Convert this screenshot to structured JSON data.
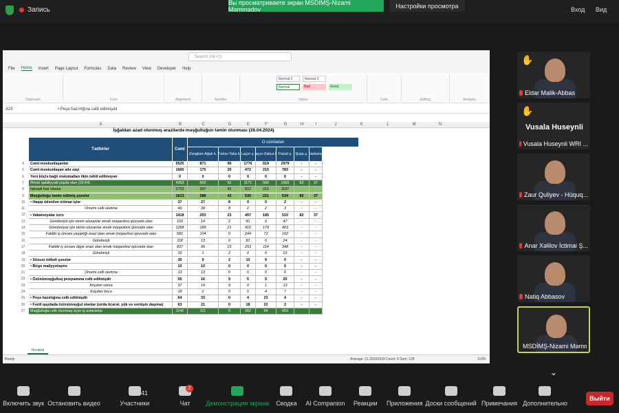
{
  "topbar": {
    "record_label": "Запись",
    "share_banner": "Вы просматриваете экран MSDİMŞ-Nizami Məmmədov",
    "view_settings": "Настройки просмотра",
    "enter_label": "Вход",
    "view_label": "Вид"
  },
  "excel": {
    "doc_title": "İşğaldan azad olunmuş ərazilərdə məşğulluğun təmin olunması (26.04.2024)",
    "search_placeholder": "Search (Alt+Q)",
    "menus": [
      "File",
      "Home",
      "Insert",
      "Page Layout",
      "Formulas",
      "Data",
      "Review",
      "View",
      "Developer",
      "Help"
    ],
    "cell_ref": "A25",
    "formula": "• Peşə hazırlığına cəlb edilmişdir",
    "styles": {
      "normal2": "Normal 2",
      "normal3": "Normal 3",
      "normal": "Normal",
      "bad": "Bad",
      "good": "Good"
    },
    "ribbon_groups": [
      "Clipboard",
      "Font",
      "Alignment",
      "Number",
      "Styles",
      "Cells",
      "Editing",
      "Analysis"
    ],
    "columns": [
      "A",
      "B",
      "C",
      "D",
      "E",
      "F",
      "G",
      "H",
      "I",
      "J",
      "K",
      "L",
      "M",
      "N"
    ],
    "headers": {
      "tadbirlar": "Tədbirlər",
      "cami": "Cəmi",
      "o_cumleden": "O cümlədən",
      "c1": "Zəngilan-Ağalı k.",
      "c2": "Tərtər-Talış k.",
      "c3": "Laçın ş.",
      "c4": "Laçın-Zabux k.",
      "c5": "Füzuli ş.",
      "c6": "Şuşa ş.",
      "c7": "Xankəndi"
    },
    "rows": [
      {
        "n": "4",
        "cls": "bold",
        "c": [
          "Cəmi məskunlaşanlar",
          "6525",
          "871",
          "90",
          "1776",
          "819",
          "2979",
          "-",
          "-"
        ]
      },
      {
        "n": "5",
        "cls": "bold",
        "c": [
          "Cəmi məskunlaşan ailə sayı",
          "1665",
          "175",
          "20",
          "472",
          "215",
          "783",
          "-",
          "-"
        ]
      },
      {
        "n": "6",
        "cls": "bold",
        "c": [
          "Yeni köçlə bağlı məlumatları ilkin təhlil edilməyən",
          "0",
          "0",
          "0",
          "0",
          "0",
          "0",
          "-",
          "-"
        ]
      },
      {
        "n": "7",
        "cls": "green",
        "c": [
          "Əmək qabiliyyətli yaşda olan (15-64)",
          "4353",
          "602",
          "52",
          "1171",
          "566",
          "1962",
          "82",
          "37"
        ]
      },
      {
        "n": "8",
        "cls": "lg",
        "c": [
          "İqtisadi fəal olanlar",
          "2753",
          "397",
          "42",
          "812",
          "315",
          "1187",
          "",
          ""
        ]
      },
      {
        "n": "9",
        "cls": "lg bold",
        "c": [
          "Məşğulluğu təmin edilmiş şəxslər",
          "1613",
          "286",
          "42",
          "530",
          "221",
          "534",
          "82",
          "37"
        ]
      },
      {
        "n": "10",
        "cls": "bold",
        "c": [
          "• Haqqı ödənilən ictimai işlər",
          "37",
          "27",
          "8",
          "0",
          "0",
          "2",
          "-",
          "-"
        ]
      },
      {
        "n": "11",
        "cls": "it",
        "c": [
          "Ümumi cəlb olunma",
          "49",
          "34",
          "8",
          "2",
          "2",
          "3",
          "-",
          "-"
        ]
      },
      {
        "n": "12",
        "cls": "bold",
        "c": [
          "• Vakansiyalar üzrə",
          "1418",
          "203",
          "23",
          "497",
          "185",
          "510",
          "82",
          "37"
        ]
      },
      {
        "n": "13",
        "cls": "it",
        "c": [
          "Gəndərişlə işlə təmin olunanlar əmək müqaviləsi qüvvədə olan",
          "150",
          "14",
          "2",
          "81",
          "6",
          "47",
          "-",
          "-"
        ]
      },
      {
        "n": "14",
        "cls": "it",
        "c": [
          "Göndərişsiz işlə təmin olunanlar əmək müqaviləsi qüvvədə olan",
          "1268",
          "189",
          "21",
          "416",
          "179",
          "463",
          "-",
          "-"
        ]
      },
      {
        "n": "15",
        "cls": "it",
        "c": [
          "Faktiki iş ünvanı yaşadığı ərazi olan əmək müqaviləsi qüvvədə olan",
          "581",
          "104",
          "0",
          "244",
          "71",
          "162",
          "-",
          "-"
        ]
      },
      {
        "n": "16",
        "cls": "it",
        "c": [
          "Göndərişli",
          "118",
          "13",
          "0",
          "81",
          "0",
          "24",
          "-",
          "-"
        ]
      },
      {
        "n": "17",
        "cls": "it",
        "c": [
          "Faktiki iş ünvanı digər ərazi olan əmək müqaviləsi qüvvədə olan",
          "837",
          "99",
          "23",
          "253",
          "114",
          "348",
          "-",
          "-"
        ]
      },
      {
        "n": "18",
        "cls": "it",
        "c": [
          "Göndərişli",
          "32",
          "1",
          "2",
          "0",
          "6",
          "23",
          "-",
          "-"
        ]
      },
      {
        "n": "19",
        "cls": "bold",
        "c": [
          "• Xüsusi rütbəli şəxslər",
          "30",
          "9",
          "2",
          "10",
          "9",
          "0",
          "-",
          "-"
        ]
      },
      {
        "n": "20",
        "cls": "bold",
        "c": [
          "• Birgə maliyyələşmə",
          "10",
          "10",
          "0",
          "0",
          "0",
          "0",
          "-",
          "-"
        ]
      },
      {
        "n": "21",
        "cls": "it",
        "c": [
          "Ümumi cəlb olunma",
          "13",
          "13",
          "0",
          "0",
          "0",
          "0",
          "-",
          "-"
        ]
      },
      {
        "n": "22",
        "cls": "bold",
        "c": [
          "• Özünüməşğulluq proqramına cəlb edilmişdir",
          "55",
          "16",
          "9",
          "5",
          "5",
          "20",
          "-",
          "-"
        ]
      },
      {
        "n": "23",
        "cls": "it",
        "c": [
          "Köçdən sonra",
          "37",
          "14",
          "9",
          "0",
          "1",
          "13",
          "-",
          "-"
        ]
      },
      {
        "n": "24",
        "cls": "it",
        "c": [
          "Köçdən öncə",
          "18",
          "2",
          "0",
          "5",
          "4",
          "7",
          "-",
          "-"
        ]
      },
      {
        "n": "25",
        "cls": "bold",
        "c": [
          "• Peşə hazırlığına cəlb edilmişdir",
          "64",
          "33",
          "0",
          "4",
          "23",
          "4",
          "-",
          "-"
        ]
      },
      {
        "n": "26",
        "cls": "bold",
        "c": [
          "• Fərdi qaydada özünüməşğul olanlar (xırda ticarət, yük və sərnişin daşıma)",
          "63",
          "21",
          "0",
          "18",
          "22",
          "2",
          "-",
          "-"
        ]
      },
      {
        "n": "27",
        "cls": "green",
        "c": [
          "Məşğulluğa cəlb olunmaq üçün iş axtaranlar",
          "1140",
          "111",
          "0",
          "282",
          "94",
          "653",
          "",
          ""
        ]
      }
    ],
    "sheet_tab": "Hesabat",
    "status_left": "Ready",
    "status_mid": "Average: 21.33333333   Count: 9   Sum: 128",
    "zoom": "119%"
  },
  "participants": [
    {
      "name": "Eldar Malik-Abbas",
      "hand": true
    },
    {
      "name": "Vusala Huseynli  WRI ...",
      "big": "Vusala Huseynli",
      "hand": true
    },
    {
      "name": "Zaur Quliyev - Hüquq...",
      "hand": false
    },
    {
      "name": "Anar Xəlilov İctimai Ş...",
      "hand": false
    },
    {
      "name": "Natiq Abbasov",
      "hand": false
    },
    {
      "name": "MSDİMŞ-Nizami Məmm...",
      "hand": false,
      "active": true
    }
  ],
  "bottombar": {
    "mute": "Включить звук",
    "video": "Остановить видео",
    "participants": "Участники",
    "participants_count": "41",
    "chat": "Чат",
    "chat_badge": "2",
    "share": "Демонстрация экрана",
    "summary": "Сводка",
    "ai": "AI Companion",
    "reactions": "Реакции",
    "apps": "Приложения",
    "docs": "Доски сообщений",
    "notes": "Примечания",
    "more": "Дополнительно",
    "leave": "Выйти"
  }
}
